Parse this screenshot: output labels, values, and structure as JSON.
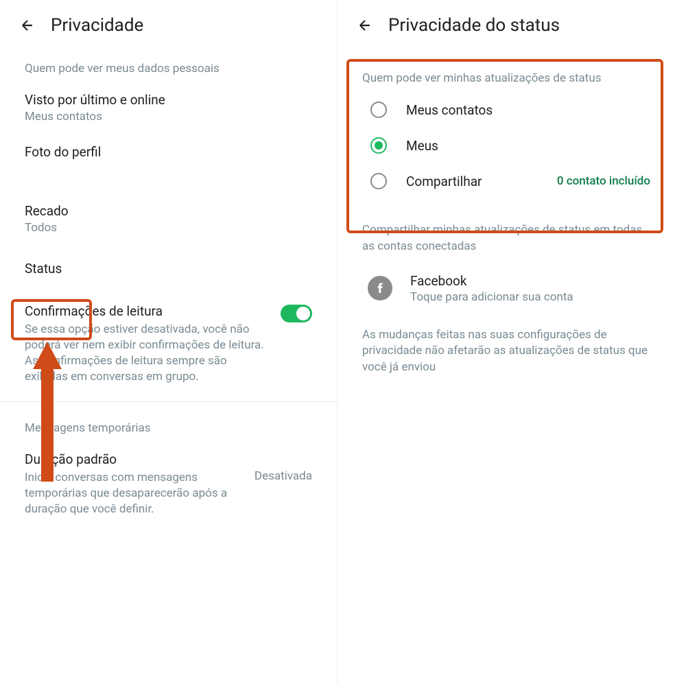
{
  "left": {
    "header_title": "Privacidade",
    "section_personal": "Quem pode ver meus dados pessoais",
    "last_seen": {
      "title": "Visto por último e online",
      "subtitle": "Meus contatos"
    },
    "profile_photo": {
      "title": "Foto do perfil"
    },
    "about": {
      "title": "Recado",
      "subtitle": "Todos"
    },
    "status": {
      "title": "Status"
    },
    "read_receipts": {
      "title": "Confirmações de leitura",
      "desc": "Se essa opção estiver desativada, você não poderá ver nem exibir confirmações de leitura. As confirmações de leitura sempre são exibidas em conversas em grupo."
    },
    "section_disappearing": "Mensagens temporárias",
    "default_duration": {
      "title": "Duração padrão",
      "desc": "Inicie conversas com mensagens temporárias que desaparecerão após a duração que você definir.",
      "value": "Desativada"
    }
  },
  "right": {
    "header_title": "Privacidade do status",
    "section_who": "Quem pode ver minhas atualizações de status",
    "options": [
      {
        "label": "Meus contatos",
        "selected": false,
        "extra": ""
      },
      {
        "label": "Meus",
        "selected": true,
        "extra": ""
      },
      {
        "label": "Compartilhar",
        "selected": false,
        "extra": "0 contato incluído"
      }
    ],
    "section_share": "Compartilhar minhas atualizações de status em todas as contas conectadas",
    "facebook": {
      "title": "Facebook",
      "subtitle": "Toque para adicionar sua conta"
    },
    "footer_info": "As mudanças feitas nas suas configurações de privacidade não afetarão as atualizações de status que você já enviou"
  }
}
